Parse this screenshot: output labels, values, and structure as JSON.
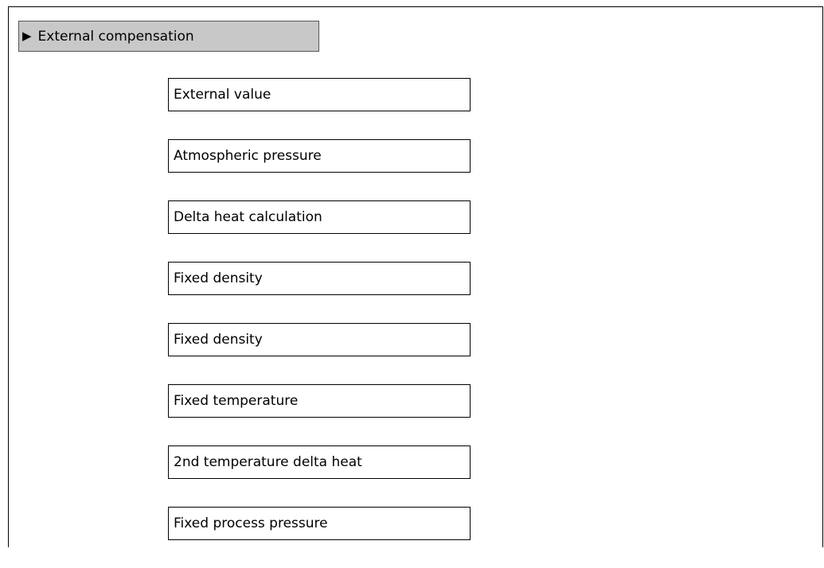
{
  "submenu": {
    "arrow_icon": "triangle-right-icon",
    "title": "External compensation"
  },
  "parameters": [
    "External value",
    "Atmospheric pressure",
    "Delta heat calculation",
    "Fixed density",
    "Fixed density",
    "Fixed temperature",
    "2nd temperature delta heat",
    "Fixed process pressure"
  ]
}
